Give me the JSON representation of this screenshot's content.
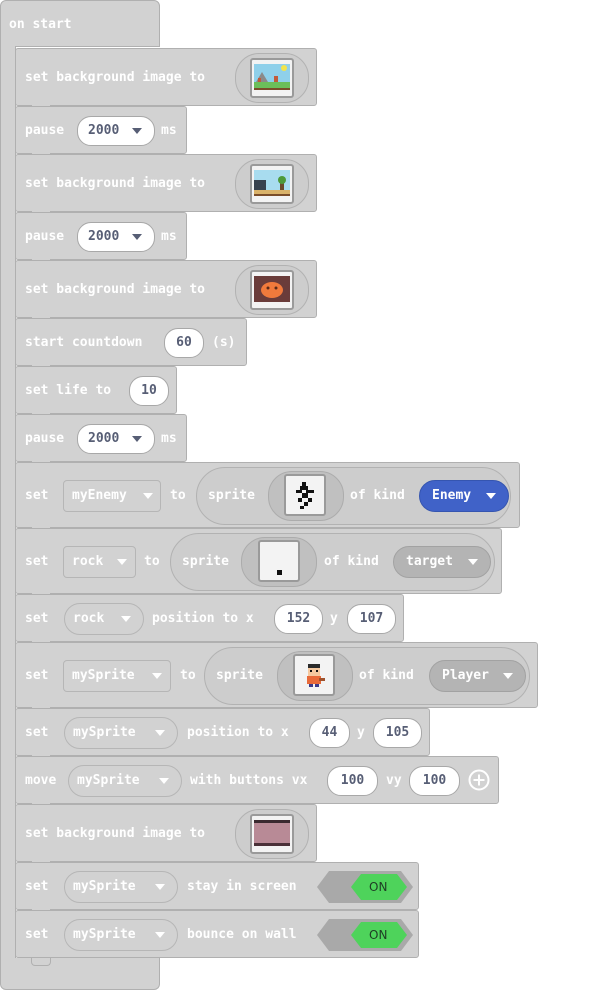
{
  "hat": {
    "label": "on start"
  },
  "labels": {
    "set_bg": "set background image to",
    "pause": "pause",
    "ms": "ms",
    "start_countdown": "start countdown",
    "seconds_unit": "(s)",
    "set_life_to": "set life to",
    "set": "set",
    "to": "to",
    "sprite": "sprite",
    "of_kind": "of kind",
    "position_to_x": "position to x",
    "y": "y",
    "move": "move",
    "with_buttons_vx": "with buttons vx",
    "vy": "vy",
    "stay_in_screen": "stay in screen",
    "bounce_on_wall": "bounce on wall"
  },
  "values": {
    "pause1": "2000",
    "pause2": "2000",
    "pause3": "2000",
    "countdown": "60",
    "life": "10",
    "rock_x": "152",
    "rock_y": "107",
    "sprite_x": "44",
    "sprite_y": "105",
    "vx": "100",
    "vy": "100"
  },
  "variables": {
    "my_enemy": "myEnemy",
    "rock": "rock",
    "rock_pos": "rock",
    "my_sprite": "mySprite",
    "my_sprite_pos": "mySprite",
    "my_sprite_move": "mySprite",
    "my_sprite_stay": "mySprite",
    "my_sprite_bounce": "mySprite"
  },
  "kinds": {
    "enemy": "Enemy",
    "target": "target",
    "player": "Player"
  },
  "toggles": {
    "stay_in_screen": "ON",
    "bounce_on_wall": "ON"
  },
  "colors": {
    "block_gray": "#d2d2d2",
    "enemy_kind": "#4062c8",
    "toggle_on": "#4ed35b"
  }
}
